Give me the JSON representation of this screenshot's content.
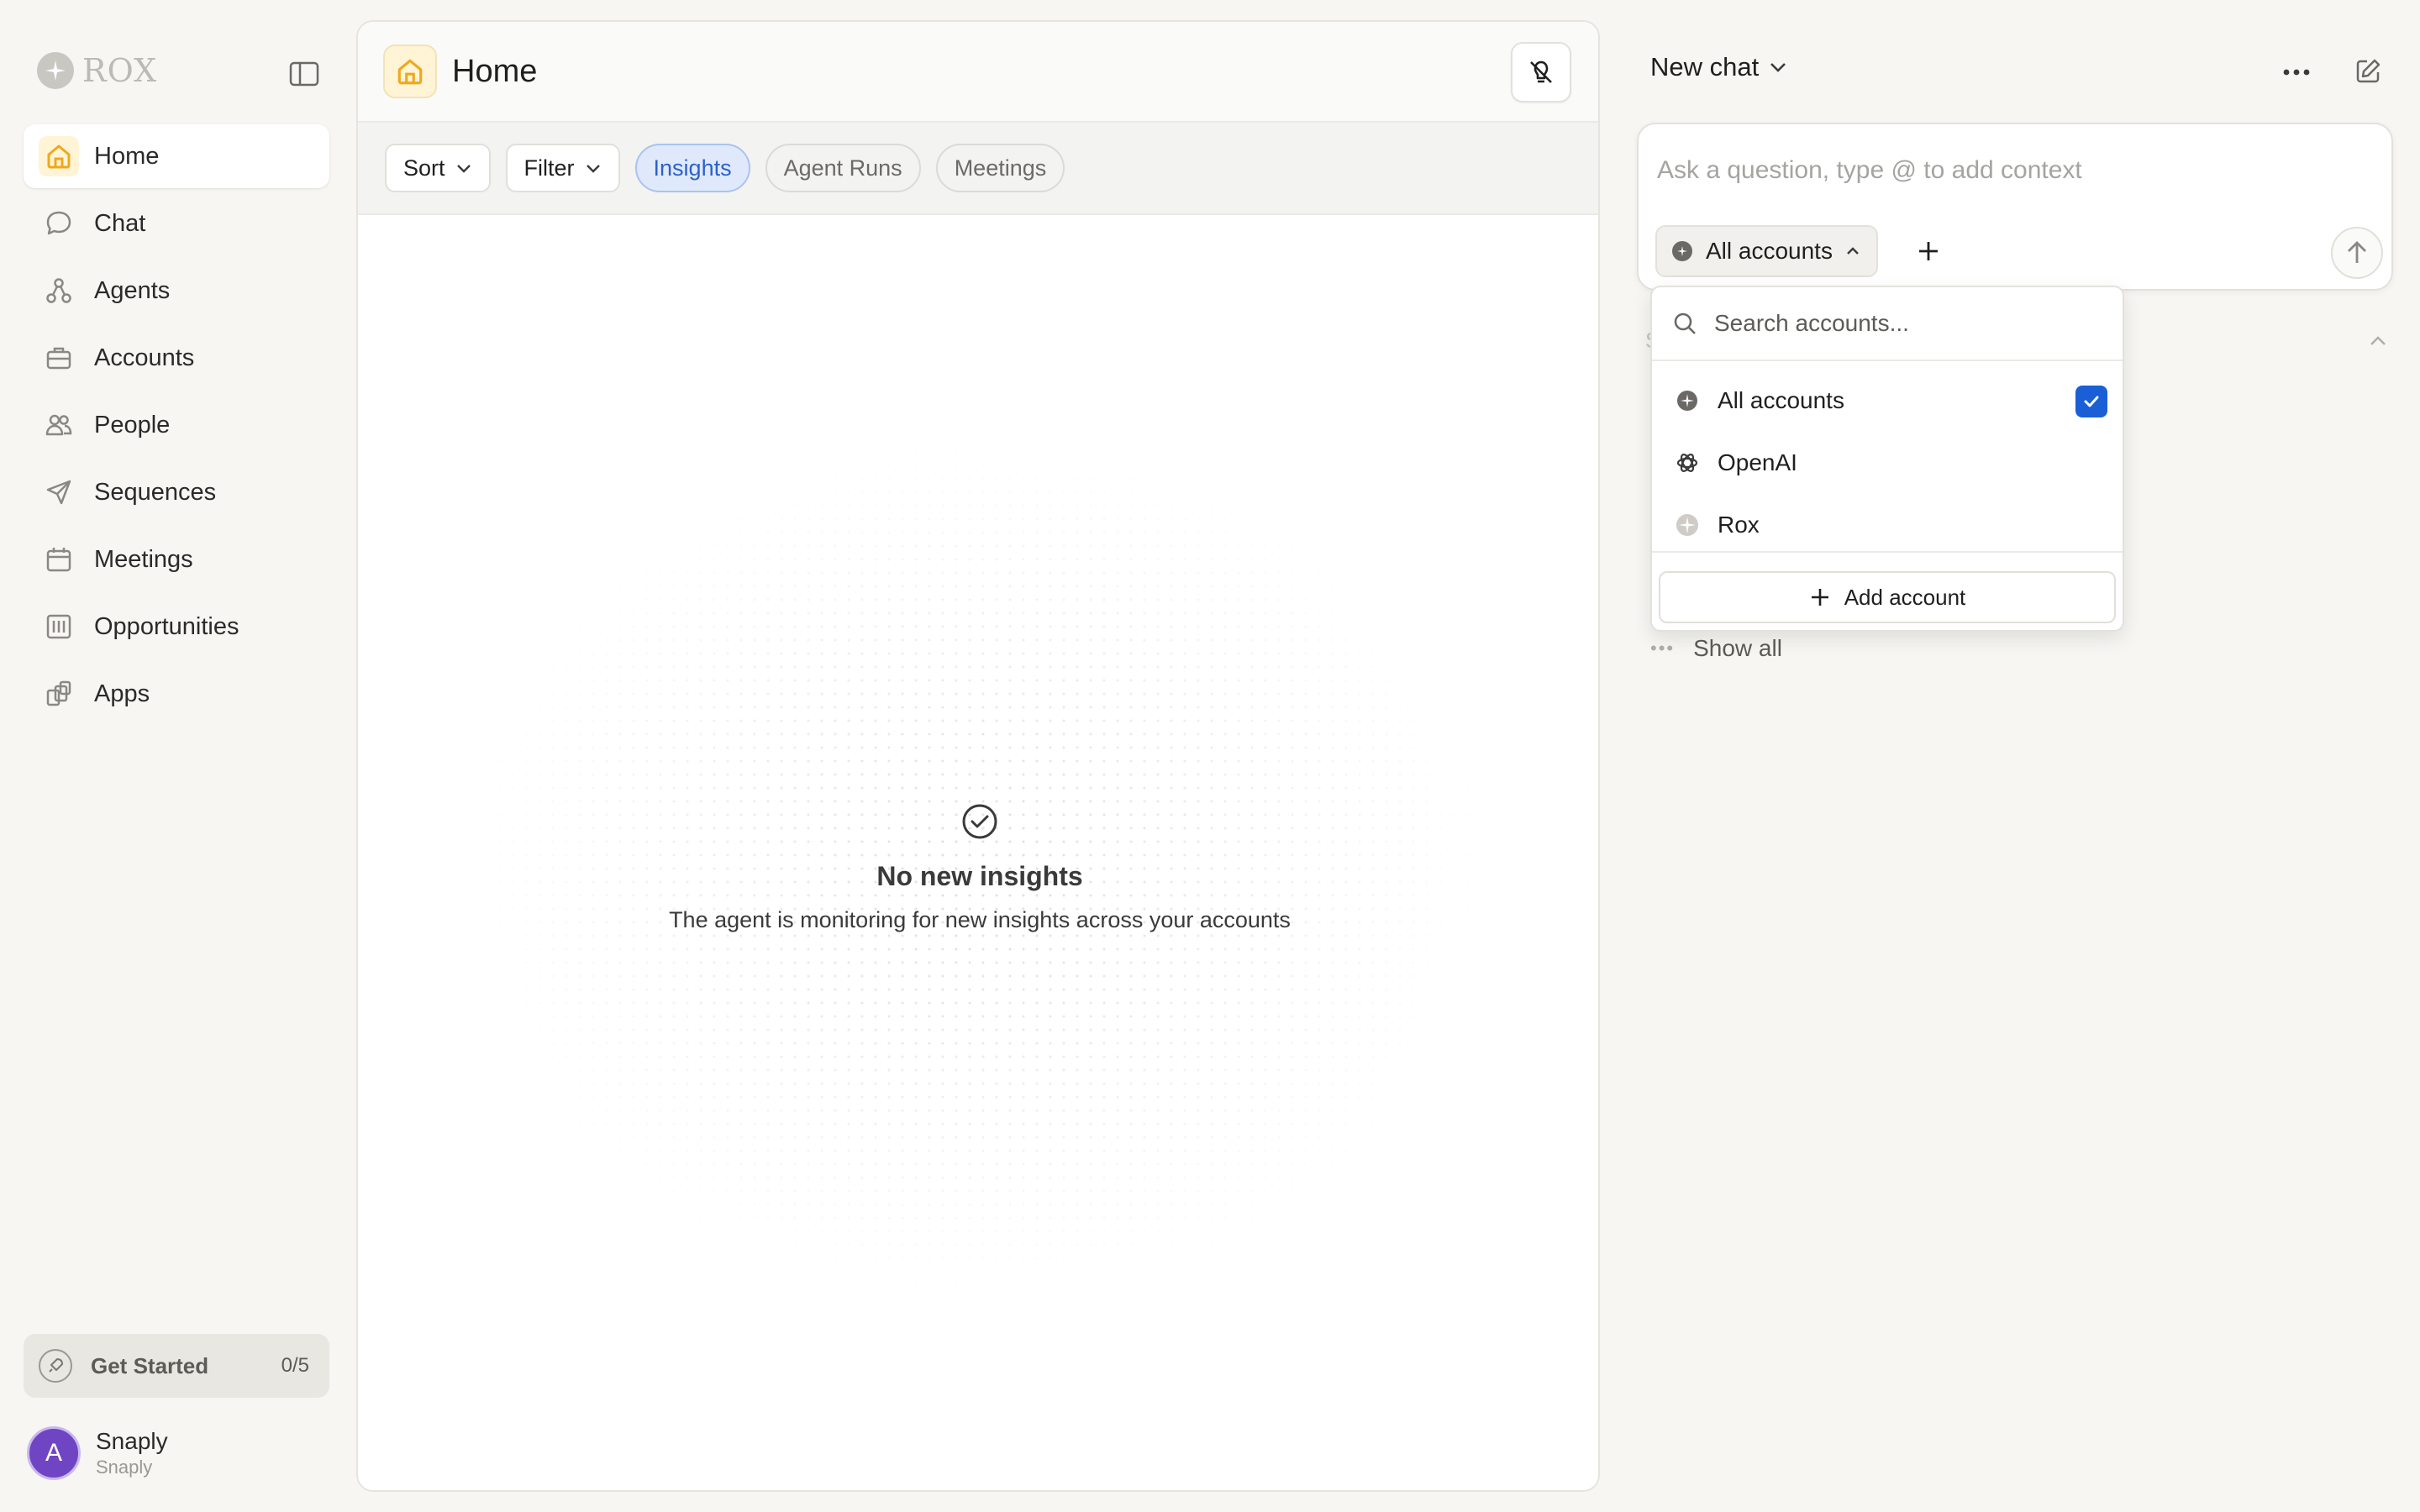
{
  "sidebar": {
    "logo_text": "ROX",
    "items": [
      {
        "label": "Home",
        "icon": "home-icon",
        "active": true
      },
      {
        "label": "Chat",
        "icon": "chat-bubble-icon"
      },
      {
        "label": "Agents",
        "icon": "agents-icon"
      },
      {
        "label": "Accounts",
        "icon": "briefcase-icon"
      },
      {
        "label": "People",
        "icon": "people-icon"
      },
      {
        "label": "Sequences",
        "icon": "send-icon"
      },
      {
        "label": "Meetings",
        "icon": "calendar-icon"
      },
      {
        "label": "Opportunities",
        "icon": "opportunities-icon"
      },
      {
        "label": "Apps",
        "icon": "apps-icon"
      }
    ],
    "get_started": {
      "label": "Get Started",
      "count": "0/5"
    },
    "user": {
      "initial": "A",
      "name": "Snaply",
      "org": "Snaply"
    }
  },
  "main": {
    "title": "Home",
    "toolbar": {
      "sort_label": "Sort",
      "filter_label": "Filter",
      "tabs": [
        {
          "label": "Insights",
          "active": true
        },
        {
          "label": "Agent Runs"
        },
        {
          "label": "Meetings"
        }
      ]
    },
    "empty_state": {
      "title": "No new insights",
      "subtitle": "The agent is monitoring for new insights across your accounts"
    }
  },
  "chat": {
    "title": "New chat",
    "input_placeholder": "Ask a question, type @ to add context",
    "account_chip": "All accounts",
    "peek_letter": "S",
    "show_all": "Show all",
    "dropdown": {
      "search_placeholder": "Search accounts...",
      "items": [
        {
          "label": "All accounts",
          "checked": true
        },
        {
          "label": "OpenAI",
          "checked": false
        },
        {
          "label": "Rox",
          "checked": false
        }
      ],
      "add_label": "Add account"
    }
  },
  "colors": {
    "accent_blue": "#1a5fd6",
    "home_accent": "#f0a81c",
    "avatar_purple": "#7045c4"
  }
}
